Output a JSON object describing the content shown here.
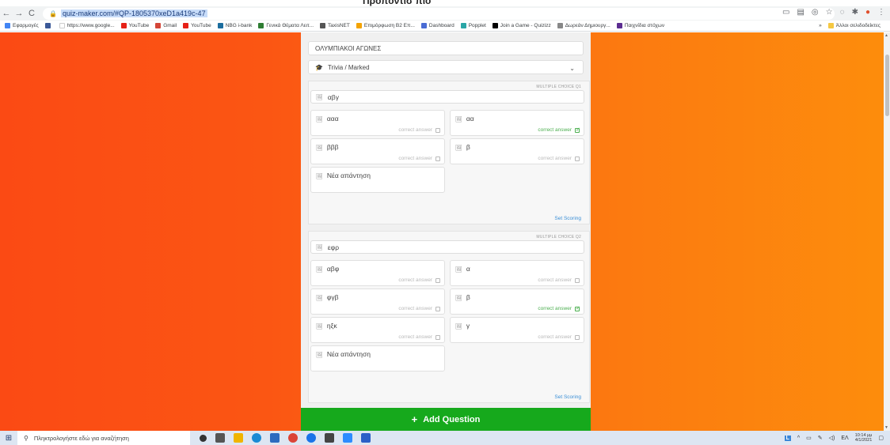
{
  "page_title_fragment": "Προπόντισ πιο",
  "browser": {
    "url": "quiz-maker.com/#QP-1805370xeD1a419c-47",
    "bookmarks": [
      {
        "label": "Εφαρμογές",
        "color": "#4285f4"
      },
      {
        "label": "",
        "color": "#3b5998"
      },
      {
        "label": "https://www.google...",
        "color": "#ffffff"
      },
      {
        "label": "YouTube",
        "color": "#e62117"
      },
      {
        "label": "Gmail",
        "color": "#d44638"
      },
      {
        "label": "YouTube",
        "color": "#e62117"
      },
      {
        "label": "NBG i-bank",
        "color": "#1b6d9e"
      },
      {
        "label": "Γενικά Θέματα Λειτ...",
        "color": "#2e7d32"
      },
      {
        "label": "TaxisNET",
        "color": "#555555"
      },
      {
        "label": "Επιμόρφωση Β2 Επ...",
        "color": "#f4a300"
      },
      {
        "label": "Dashboard",
        "color": "#4a6cd4"
      },
      {
        "label": "Popplet",
        "color": "#2aa6a6"
      },
      {
        "label": "Join a Game - Quizizz",
        "color": "#000000"
      },
      {
        "label": "Δωρεάν Δημιουργ...",
        "color": "#888888"
      },
      {
        "label": "Παιχνίδια στόχων",
        "color": "#5c2d91"
      }
    ],
    "bookmarks_overflow": "»",
    "other_bookmarks": "Άλλοι σελιδοδείκτες"
  },
  "quiz": {
    "title_value": "ΟΛΥΜΠΙΑΚΟΙ ΑΓΩΝΕΣ",
    "type_value": "Trivia / Marked",
    "questions": [
      {
        "tag": "MULTIPLE CHOICE Q1",
        "text": "αβγ",
        "answers": [
          {
            "text": "ααα",
            "correct_label": "correct answer",
            "correct": false
          },
          {
            "text": "αα",
            "correct_label": "correct answer",
            "correct": true
          },
          {
            "text": "βββ",
            "correct_label": "correct answer",
            "correct": false
          },
          {
            "text": "β",
            "correct_label": "correct answer",
            "correct": false
          }
        ],
        "new_answer": "Νέα απάντηση",
        "scoring": "Set Scoring"
      },
      {
        "tag": "MULTIPLE CHOICE Q2",
        "text": "εφρ",
        "answers": [
          {
            "text": "αβφ",
            "correct_label": "correct answer",
            "correct": false
          },
          {
            "text": "α",
            "correct_label": "correct answer",
            "correct": false
          },
          {
            "text": "φγβ",
            "correct_label": "correct answer",
            "correct": false
          },
          {
            "text": "β",
            "correct_label": "correct answer",
            "correct": true
          },
          {
            "text": "ηξκ",
            "correct_label": "correct answer",
            "correct": false
          },
          {
            "text": "γ",
            "correct_label": "correct answer",
            "correct": false
          }
        ],
        "new_answer": "Νέα απάντηση",
        "scoring": "Set Scoring"
      }
    ],
    "add_question": "Add Question"
  },
  "taskbar": {
    "search_placeholder": "Πληκτρολογήστε εδώ για αναζήτηση",
    "tray_badge": "L",
    "lang": "ΕΛ",
    "time": "10:14 μμ",
    "date": "4/1/2021"
  }
}
